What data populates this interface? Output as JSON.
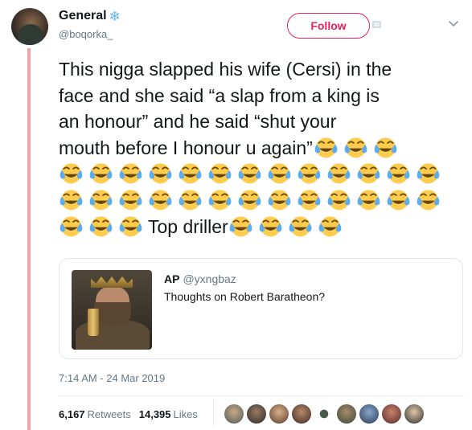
{
  "header": {
    "name": "General",
    "name_badge": "❄",
    "handle": "@boqorka_",
    "follow_label": "Follow"
  },
  "tweet": {
    "text_line1": "This nigga slapped his wife (Cersi) in the",
    "text_line2": "face and she said “a slap from a king is",
    "text_line3": "an honour” and he said “shut your",
    "text_line4": "mouth before I honour u again”",
    "text_end": "Top driller",
    "emoji_name": "face-with-tears-of-joy"
  },
  "quote": {
    "name": "AP",
    "handle": "@yxngbaz",
    "text": "Thoughts on Robert Baratheon?"
  },
  "meta": {
    "timestamp": "7:14 AM - 24 Mar 2019",
    "retweets_count": "6,167",
    "retweets_label": "Retweets",
    "likes_count": "14,395",
    "likes_label": "Likes"
  },
  "colors": {
    "accent": "#e0245e",
    "thread_line": "#f3a3a6",
    "secondary_text": "#657786",
    "emoji_face": "#ffcc4d",
    "emoji_tears": "#5dadec"
  },
  "liker_avatars": [
    "liker-1",
    "liker-2",
    "liker-3",
    "liker-4",
    "liker-5",
    "liker-6",
    "liker-7",
    "liker-8",
    "liker-9",
    "liker-10"
  ]
}
